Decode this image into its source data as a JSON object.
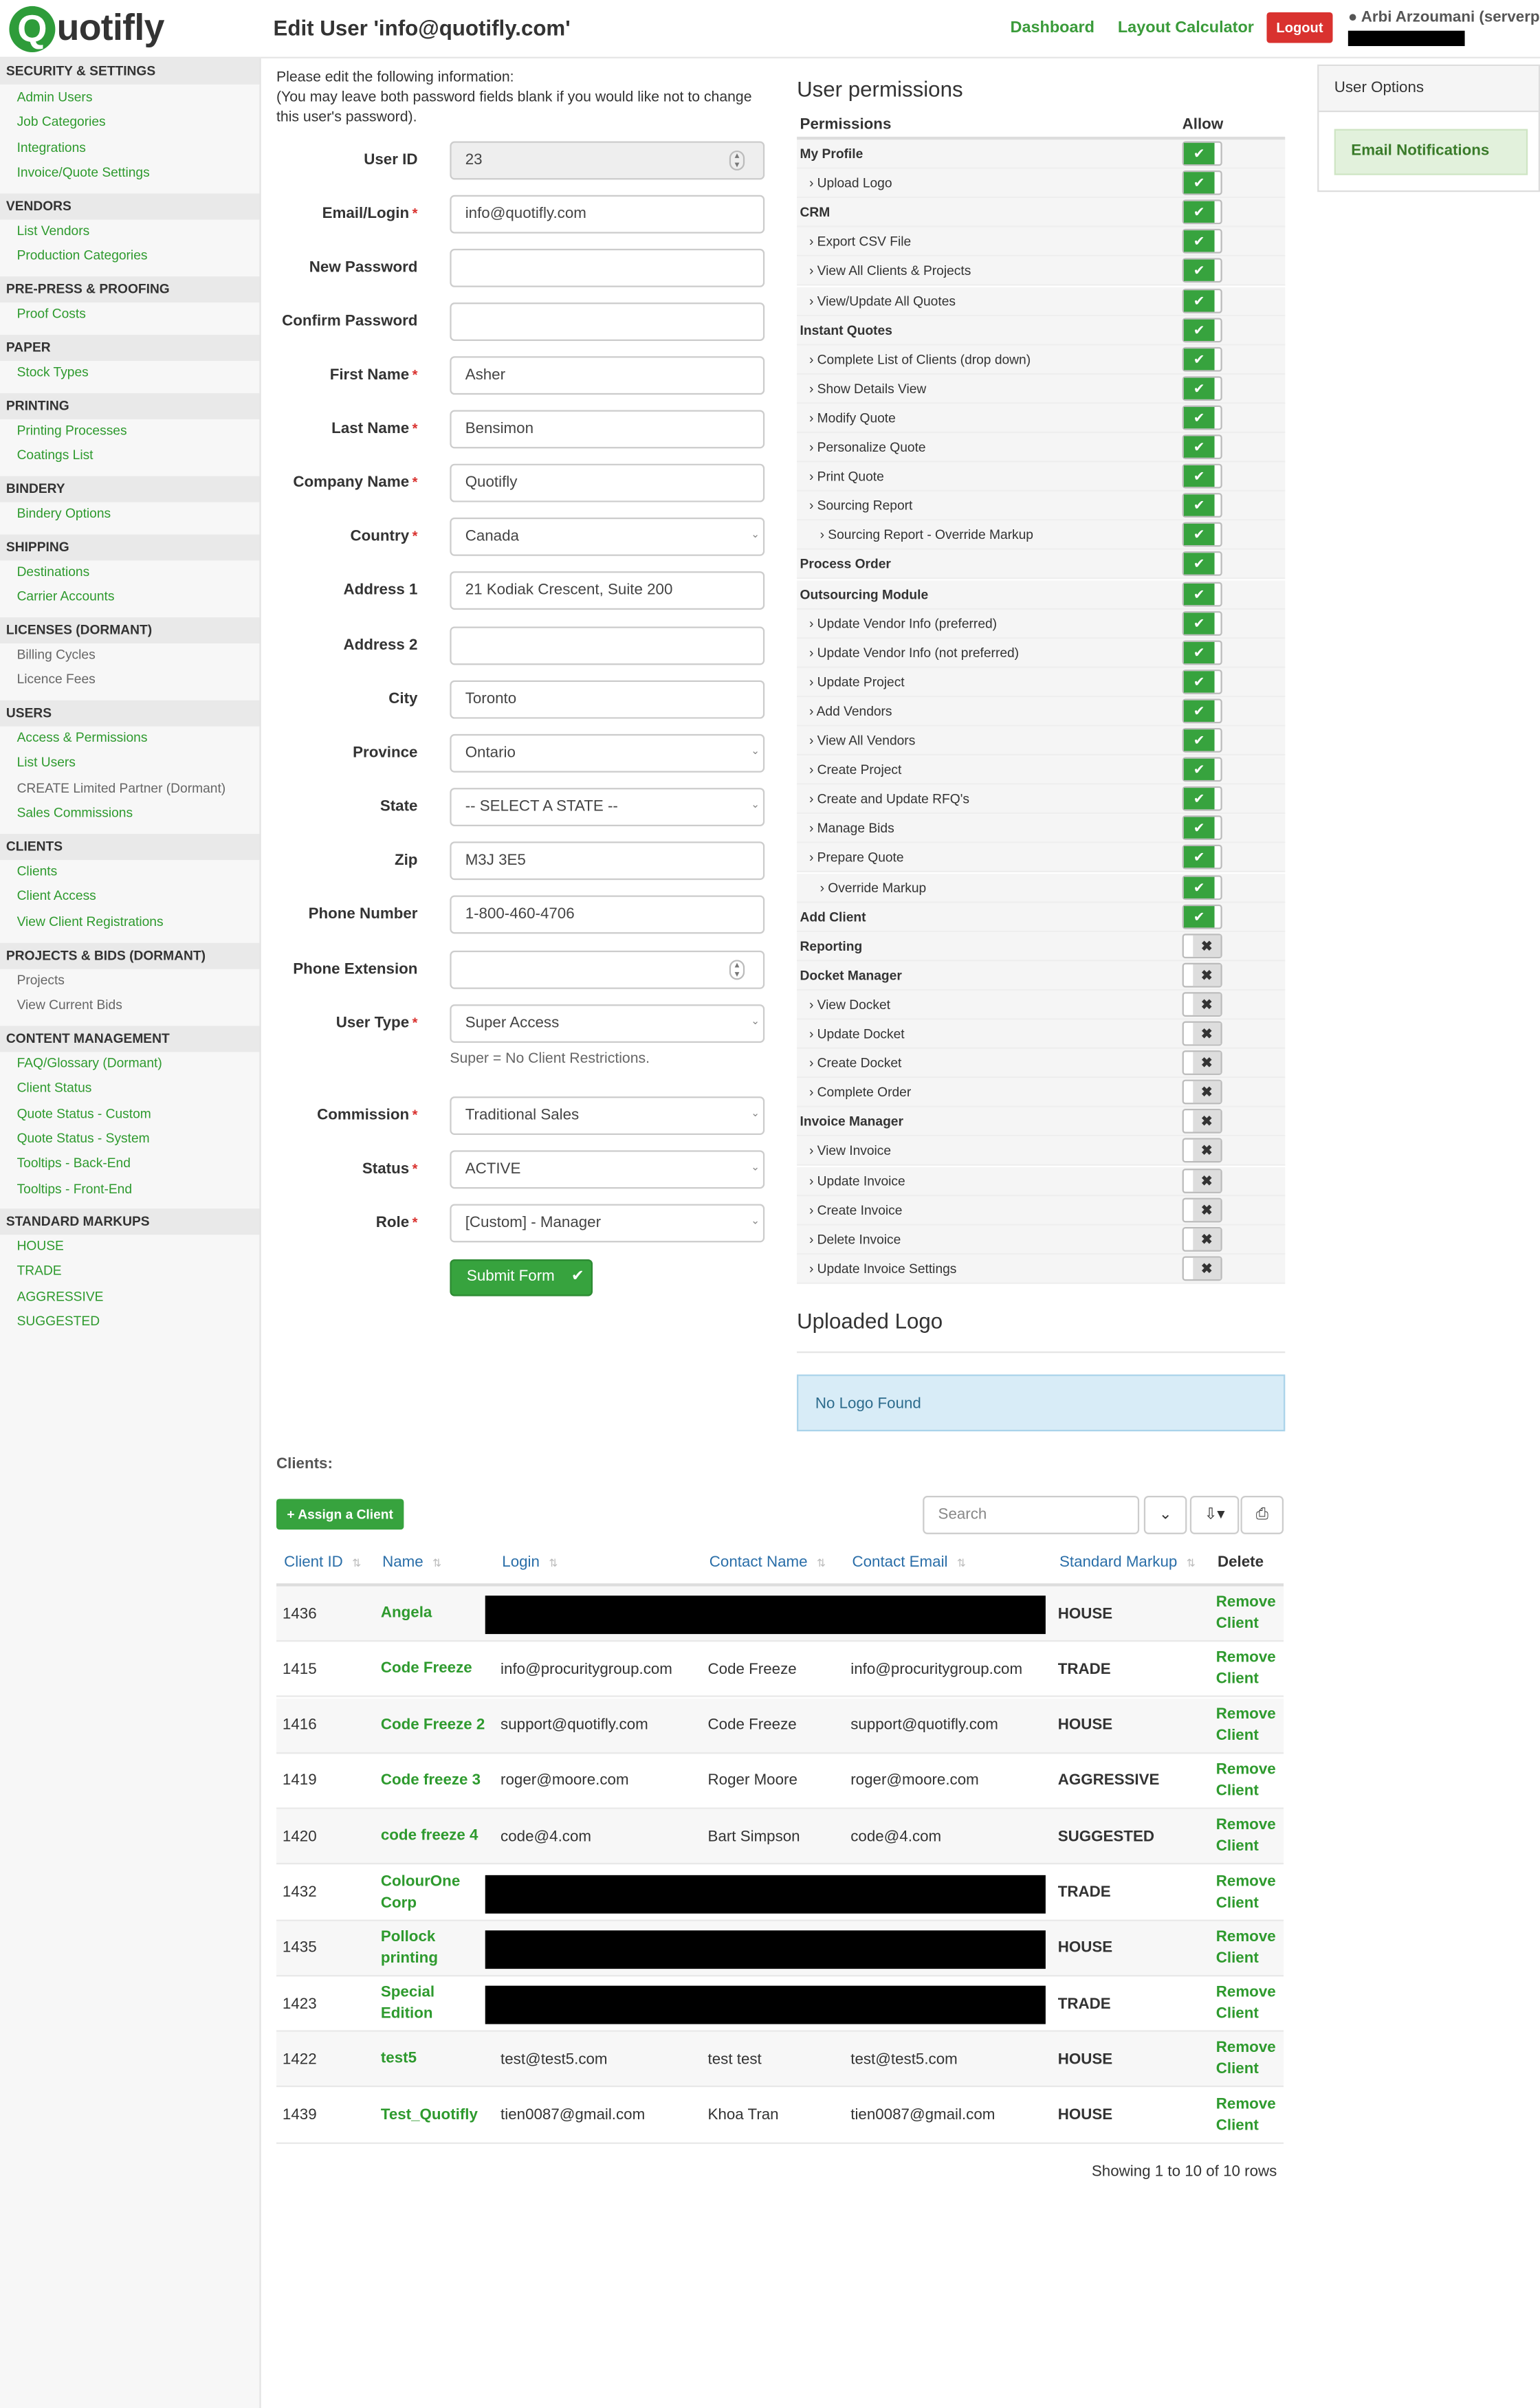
{
  "header": {
    "logo_q": "Q",
    "logo_text": "uotifly",
    "title": "Edit User 'info@quotifly.com'",
    "nav": [
      {
        "label": "Dashboard"
      },
      {
        "label": "Layout Calculator"
      }
    ],
    "logout": "Logout",
    "user": "Arbi Arzoumani (serverpi"
  },
  "sidebar": {
    "sections": [
      {
        "title": "SECURITY & SETTINGS",
        "items": [
          {
            "label": "Admin Users"
          },
          {
            "label": "Job Categories"
          },
          {
            "label": "Integrations"
          },
          {
            "label": "Invoice/Quote Settings"
          }
        ]
      },
      {
        "title": "VENDORS",
        "items": [
          {
            "label": "List Vendors"
          },
          {
            "label": "Production Categories"
          }
        ]
      },
      {
        "title": "PRE-PRESS & PROOFING",
        "items": [
          {
            "label": "Proof Costs"
          }
        ]
      },
      {
        "title": "PAPER",
        "items": [
          {
            "label": "Stock Types"
          }
        ]
      },
      {
        "title": "PRINTING",
        "items": [
          {
            "label": "Printing Processes"
          },
          {
            "label": "Coatings List"
          }
        ]
      },
      {
        "title": "BINDERY",
        "items": [
          {
            "label": "Bindery Options"
          }
        ]
      },
      {
        "title": "SHIPPING",
        "items": [
          {
            "label": "Destinations"
          },
          {
            "label": "Carrier Accounts"
          }
        ]
      },
      {
        "title": "LICENSES (DORMANT)",
        "items": [
          {
            "label": "Billing Cycles"
          },
          {
            "label": "Licence Fees"
          }
        ]
      },
      {
        "title": "USERS",
        "items": [
          {
            "label": "Access & Permissions"
          },
          {
            "label": "List Users"
          },
          {
            "label": "CREATE Limited Partner (Dormant)"
          },
          {
            "label": "Sales Commissions"
          }
        ]
      },
      {
        "title": "CLIENTS",
        "items": [
          {
            "label": "Clients"
          },
          {
            "label": "Client Access"
          },
          {
            "label": "View Client Registrations"
          }
        ]
      },
      {
        "title": "PROJECTS & BIDS (DORMANT)",
        "items": [
          {
            "label": "Projects"
          },
          {
            "label": "View Current Bids"
          }
        ]
      },
      {
        "title": "CONTENT MANAGEMENT",
        "items": [
          {
            "label": "FAQ/Glossary (Dormant)"
          },
          {
            "label": "Client Status"
          },
          {
            "label": "Quote Status - Custom"
          },
          {
            "label": "Quote Status - System"
          },
          {
            "label": "Tooltips - Back-End"
          },
          {
            "label": "Tooltips - Front-End"
          }
        ]
      },
      {
        "title": "STANDARD MARKUPS",
        "items": [
          {
            "label": "HOUSE"
          },
          {
            "label": "TRADE"
          },
          {
            "label": "AGGRESSIVE"
          },
          {
            "label": "SUGGESTED"
          }
        ]
      }
    ]
  },
  "form": {
    "intro": "Please edit the following information:\n(You may leave both password fields blank if you would like not to change this user's password).",
    "fields": [
      {
        "label": "User ID",
        "value": "23",
        "required": false,
        "kind": "spinner-ro"
      },
      {
        "label": "Email/Login",
        "value": "info@quotifly.com",
        "required": true,
        "kind": "text"
      },
      {
        "label": "New Password",
        "value": "",
        "required": false,
        "kind": "text"
      },
      {
        "label": "Confirm Password",
        "value": "",
        "required": false,
        "kind": "text"
      },
      {
        "label": "First Name",
        "value": "Asher",
        "required": true,
        "kind": "text"
      },
      {
        "label": "Last Name",
        "value": "Bensimon",
        "required": true,
        "kind": "text"
      },
      {
        "label": "Company Name",
        "value": "Quotifly",
        "required": true,
        "kind": "text"
      },
      {
        "label": "Country",
        "value": "Canada",
        "required": true,
        "kind": "select"
      },
      {
        "label": "Address 1",
        "value": "21 Kodiak Crescent, Suite 200",
        "required": false,
        "kind": "text"
      },
      {
        "label": "Address 2",
        "value": "",
        "required": false,
        "kind": "text"
      },
      {
        "label": "City",
        "value": "Toronto",
        "required": false,
        "kind": "text"
      },
      {
        "label": "Province",
        "value": "Ontario",
        "required": false,
        "kind": "select"
      },
      {
        "label": "State",
        "value": "-- SELECT A STATE --",
        "required": false,
        "kind": "select"
      },
      {
        "label": "Zip",
        "value": "M3J 3E5",
        "required": false,
        "kind": "text"
      },
      {
        "label": "Phone Number",
        "value": "1-800-460-4706",
        "required": false,
        "kind": "text"
      },
      {
        "label": "Phone Extension",
        "value": "",
        "required": false,
        "kind": "spinner"
      },
      {
        "label": "User Type",
        "value": "Super Access",
        "required": true,
        "kind": "select"
      },
      {
        "label": "Commission",
        "value": "Traditional Sales",
        "required": true,
        "kind": "select"
      },
      {
        "label": "Status",
        "value": "ACTIVE",
        "required": true,
        "kind": "select"
      },
      {
        "label": "Role",
        "value": "[Custom] - Manager",
        "required": true,
        "kind": "select"
      }
    ],
    "user_type_hint": "Super = No Client Restrictions.",
    "submit": "Submit Form"
  },
  "permissions": {
    "heading": "User permissions",
    "col_permissions": "Permissions",
    "col_allow": "Allow",
    "rows": [
      {
        "label": "My Profile",
        "level": 0,
        "on": true
      },
      {
        "label": "Upload Logo",
        "level": 1,
        "on": true
      },
      {
        "label": "CRM",
        "level": 0,
        "on": true
      },
      {
        "label": "Export CSV File",
        "level": 1,
        "on": true
      },
      {
        "label": "View All Clients & Projects",
        "level": 1,
        "on": true
      },
      {
        "label": "View/Update All Quotes",
        "level": 1,
        "on": true
      },
      {
        "label": "Instant Quotes",
        "level": 0,
        "on": true
      },
      {
        "label": "Complete List of Clients (drop down)",
        "level": 1,
        "on": true
      },
      {
        "label": "Show Details View",
        "level": 1,
        "on": true
      },
      {
        "label": "Modify Quote",
        "level": 1,
        "on": true
      },
      {
        "label": "Personalize Quote",
        "level": 1,
        "on": true
      },
      {
        "label": "Print Quote",
        "level": 1,
        "on": true
      },
      {
        "label": "Sourcing Report",
        "level": 1,
        "on": true
      },
      {
        "label": "Sourcing Report - Override Markup",
        "level": 2,
        "on": true
      },
      {
        "label": "Process Order",
        "level": 0,
        "on": true
      },
      {
        "label": "Outsourcing Module",
        "level": 0,
        "on": true
      },
      {
        "label": "Update Vendor Info (preferred)",
        "level": 1,
        "on": true
      },
      {
        "label": "Update Vendor Info (not preferred)",
        "level": 1,
        "on": true
      },
      {
        "label": "Update Project",
        "level": 1,
        "on": true
      },
      {
        "label": "Add Vendors",
        "level": 1,
        "on": true
      },
      {
        "label": "View All Vendors",
        "level": 1,
        "on": true
      },
      {
        "label": "Create Project",
        "level": 1,
        "on": true
      },
      {
        "label": "Create and Update RFQ's",
        "level": 1,
        "on": true
      },
      {
        "label": "Manage Bids",
        "level": 1,
        "on": true
      },
      {
        "label": "Prepare Quote",
        "level": 1,
        "on": true
      },
      {
        "label": "Override Markup",
        "level": 2,
        "on": true
      },
      {
        "label": "Add Client",
        "level": 0,
        "on": true
      },
      {
        "label": "Reporting",
        "level": 0,
        "on": false
      },
      {
        "label": "Docket Manager",
        "level": 0,
        "on": false
      },
      {
        "label": "View Docket",
        "level": 1,
        "on": false
      },
      {
        "label": "Update Docket",
        "level": 1,
        "on": false
      },
      {
        "label": "Create Docket",
        "level": 1,
        "on": false
      },
      {
        "label": "Complete Order",
        "level": 1,
        "on": false
      },
      {
        "label": "Invoice Manager",
        "level": 0,
        "on": false
      },
      {
        "label": "View Invoice",
        "level": 1,
        "on": false
      },
      {
        "label": "Update Invoice",
        "level": 1,
        "on": false
      },
      {
        "label": "Create Invoice",
        "level": 1,
        "on": false
      },
      {
        "label": "Delete Invoice",
        "level": 1,
        "on": false
      },
      {
        "label": "Update Invoice Settings",
        "level": 1,
        "on": false
      }
    ]
  },
  "logo_section": {
    "heading": "Uploaded Logo",
    "message": "No Logo Found"
  },
  "user_options": {
    "heading": "User Options",
    "button": "Email Notifications"
  },
  "clients": {
    "label": "Clients:",
    "assign": "+ Assign a Client",
    "search_placeholder": "Search",
    "columns": [
      "Client ID",
      "Name",
      "Login",
      "Contact Name",
      "Contact Email",
      "Standard Markup",
      "Delete"
    ],
    "rows": [
      {
        "id": "1436",
        "name": "Angela",
        "login": "",
        "contact": "",
        "email": "",
        "markup": "HOUSE",
        "redacted": true
      },
      {
        "id": "1415",
        "name": "Code Freeze",
        "login": "info@procuritygroup.com",
        "contact": "Code Freeze",
        "email": "info@procuritygroup.com",
        "markup": "TRADE",
        "redacted": false
      },
      {
        "id": "1416",
        "name": "Code Freeze 2",
        "login": "support@quotifly.com",
        "contact": "Code Freeze",
        "email": "support@quotifly.com",
        "markup": "HOUSE",
        "redacted": false
      },
      {
        "id": "1419",
        "name": "Code freeze 3",
        "login": "roger@moore.com",
        "contact": "Roger Moore",
        "email": "roger@moore.com",
        "markup": "AGGRESSIVE",
        "redacted": false
      },
      {
        "id": "1420",
        "name": "code freeze 4",
        "login": "code@4.com",
        "contact": "Bart Simpson",
        "email": "code@4.com",
        "markup": "SUGGESTED",
        "redacted": false
      },
      {
        "id": "1432",
        "name": "ColourOne Corp",
        "login": "",
        "contact": "",
        "email": "",
        "markup": "TRADE",
        "redacted": true
      },
      {
        "id": "1435",
        "name": "Pollock printing",
        "login": "",
        "contact": "",
        "email": "",
        "markup": "HOUSE",
        "redacted": true
      },
      {
        "id": "1423",
        "name": "Special Edition",
        "login": "",
        "contact": "",
        "email": "",
        "markup": "TRADE",
        "redacted": true
      },
      {
        "id": "1422",
        "name": "test5",
        "login": "test@test5.com",
        "contact": "test test",
        "email": "test@test5.com",
        "markup": "HOUSE",
        "redacted": false
      },
      {
        "id": "1439",
        "name": "Test_Quotifly",
        "login": "tien0087@gmail.com",
        "contact": "Khoa Tran",
        "email": "tien0087@gmail.com",
        "markup": "HOUSE",
        "redacted": false
      }
    ],
    "remove_label": "Remove Client",
    "footer": "Showing 1 to 10 of 10 rows"
  },
  "colors": {
    "brand_green": "#37a33e",
    "link_green": "#2e9a2e",
    "logout_red": "#d9322f",
    "link_blue": "#2a6ea8"
  },
  "icons": {
    "user": "user-icon",
    "toggle_on": "check-icon",
    "toggle_off": "x-icon",
    "export": "export-icon",
    "print": "print-icon",
    "chevron": "chevron-down-icon"
  }
}
